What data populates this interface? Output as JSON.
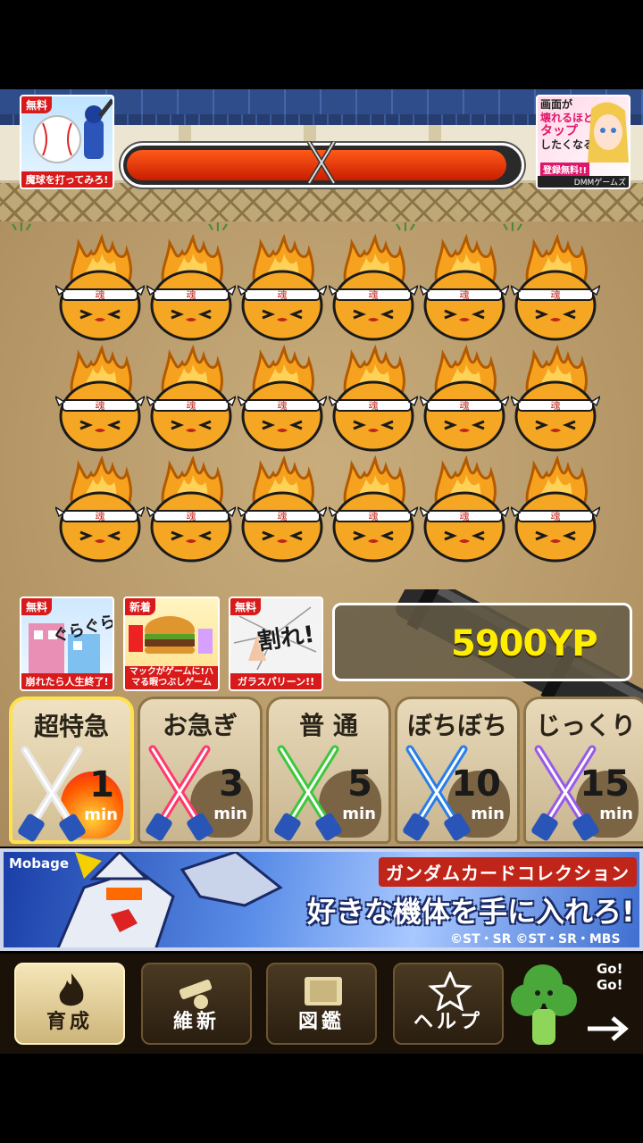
{
  "top_ads": {
    "left": {
      "badge": "無料",
      "caption": "魔球を打ってみろ!"
    },
    "right": {
      "line1": "画面が",
      "line2": "壊れるほど",
      "line3": "タップ",
      "line4": "したくなる!",
      "badge": "登録無料!!",
      "brand": "DMMゲームズ"
    }
  },
  "hp_bar": {
    "fill_fraction": 0.97,
    "icon": "crossed-swords-icon"
  },
  "characters": {
    "rows": 3,
    "cols": 6,
    "headband_text": "魂"
  },
  "bottom_ads": [
    {
      "badge": "無料",
      "caption": "崩れたら人生終了!",
      "art_text": "ぐらぐら"
    },
    {
      "badge": "新着",
      "caption": "マックがゲームに!ハマる暇つぶしゲーム",
      "art_text": ""
    },
    {
      "badge": "無料",
      "caption": "ガラスパリーン!!",
      "art_text": "割れ!"
    }
  ],
  "currency": {
    "value": "5900YP"
  },
  "speed_buttons": [
    {
      "label": "超特急",
      "num": "1",
      "unit": "min",
      "color": "#e8e8e8",
      "active": true
    },
    {
      "label": "お急ぎ",
      "num": "3",
      "unit": "min",
      "color": "#ff3a6e",
      "active": false
    },
    {
      "label": "普 通",
      "num": "5",
      "unit": "min",
      "color": "#3cc83c",
      "active": false
    },
    {
      "label": "ぼちぼち",
      "num": "10",
      "unit": "min",
      "color": "#2a7ee8",
      "active": false
    },
    {
      "label": "じっくり",
      "num": "15",
      "unit": "min",
      "color": "#9a5ae8",
      "active": false
    }
  ],
  "banner": {
    "brand": "Mobage",
    "title": "ガンダムカードコレクション",
    "catch": "好きな機体を手に入れろ!",
    "copyright": "©ST・SR ©ST・SR・MBS"
  },
  "nav": [
    {
      "label": "育成",
      "icon": "flame-icon",
      "active": true
    },
    {
      "label": "維新",
      "icon": "cannon-icon",
      "active": false
    },
    {
      "label": "図鑑",
      "icon": "book-icon",
      "active": false
    },
    {
      "label": "ヘルプ",
      "icon": "star-icon",
      "active": false
    }
  ],
  "gogo": {
    "line1": "Go!",
    "line2": "Go!"
  }
}
